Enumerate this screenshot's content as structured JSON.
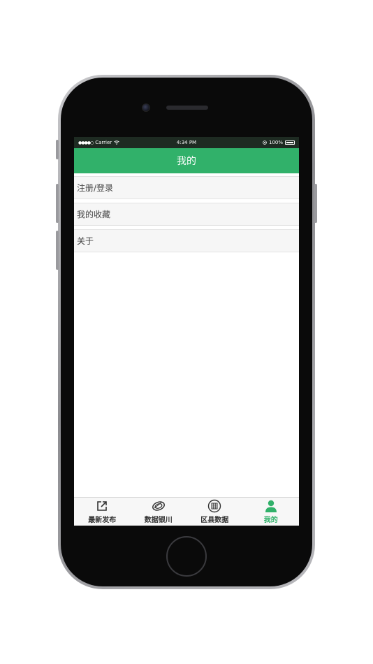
{
  "status_bar": {
    "signal": "●●●●○",
    "carrier": "Carrier",
    "time": "4:34 PM",
    "battery": "100%"
  },
  "nav": {
    "title": "我的"
  },
  "menu": {
    "items": [
      {
        "label": "注册/登录"
      },
      {
        "label": "我的收藏"
      },
      {
        "label": "关于"
      }
    ]
  },
  "tabs": [
    {
      "label": "最新发布",
      "icon": "share-external-icon"
    },
    {
      "label": "数据银川",
      "icon": "ring-logo-icon"
    },
    {
      "label": "区县数据",
      "icon": "grid-circle-icon"
    },
    {
      "label": "我的",
      "icon": "person-icon",
      "active": true
    }
  ],
  "colors": {
    "accent": "#31b16a",
    "status_bar_bg": "#1e2b22"
  }
}
